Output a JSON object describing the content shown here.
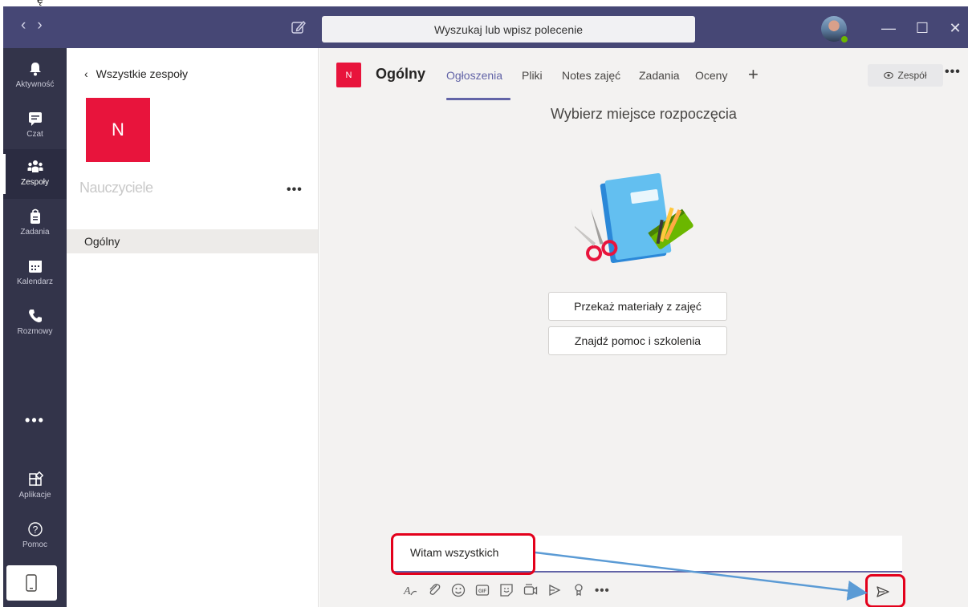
{
  "title_bar": {
    "search_placeholder": "Wyszukaj lub wpisz polecenie",
    "top_glyph": "ę"
  },
  "rail": {
    "items": [
      {
        "label": "Aktywność",
        "icon": "bell-icon"
      },
      {
        "label": "Czat",
        "icon": "chat-icon"
      },
      {
        "label": "Zespoły",
        "icon": "teams-icon",
        "active": true
      },
      {
        "label": "Zadania",
        "icon": "assignments-icon"
      },
      {
        "label": "Kalendarz",
        "icon": "calendar-icon"
      },
      {
        "label": "Rozmowy",
        "icon": "phone-icon"
      },
      {
        "label": "Aplikacje",
        "icon": "apps-icon"
      },
      {
        "label": "Pomoc",
        "icon": "help-icon"
      }
    ],
    "more_label": "•••"
  },
  "teams_panel": {
    "back_label": "Wszystkie zespoły",
    "team_initial": "N",
    "team_name": "Nauczyciele",
    "more_label": "•••",
    "channels": [
      "Ogólny"
    ]
  },
  "channel_header": {
    "initial": "N",
    "name": "Ogólny",
    "tabs": [
      "Ogłoszenia",
      "Pliki",
      "Notes zajęć",
      "Zadania",
      "Oceny"
    ],
    "active_tab": "Ogłoszenia",
    "team_button": "Zespół",
    "more_label": "•••"
  },
  "main": {
    "start_title": "Wybierz miejsce rozpoczęcia",
    "buttons": [
      "Przekaż materiały z zajęć",
      "Znajdź pomoc i szkolenia"
    ]
  },
  "compose": {
    "text": "Witam wszystkich",
    "more_label": "•••"
  },
  "colors": {
    "titlebar": "#464775",
    "rail": "#33344a",
    "accent": "#6264a7",
    "team_tile": "#e8143c",
    "highlight": "#e3001b",
    "arrow": "#5b9bd5"
  }
}
